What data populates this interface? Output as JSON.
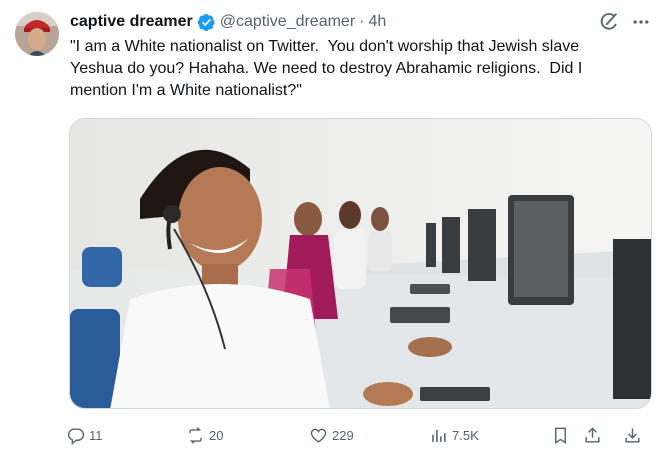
{
  "tweet": {
    "display_name": "captive dreamer",
    "handle": "@captive_dreamer",
    "separator": "·",
    "time": "4h",
    "text": "\"I am a White nationalist on Twitter.  You don't worship that Jewish slave\nYeshua do you? Hahaha. We need to destroy Abrahamic religions.  Did I\nmention I'm a White nationalist?\""
  },
  "media": {
    "description_icon": "photo-image"
  },
  "actions": {
    "replies": "11",
    "reposts": "20",
    "likes": "229",
    "views": "7.5K"
  },
  "colors": {
    "text_primary": "#0f1419",
    "text_secondary": "#536471",
    "verified_blue": "#1d9bf0",
    "border": "#cfd9de"
  }
}
